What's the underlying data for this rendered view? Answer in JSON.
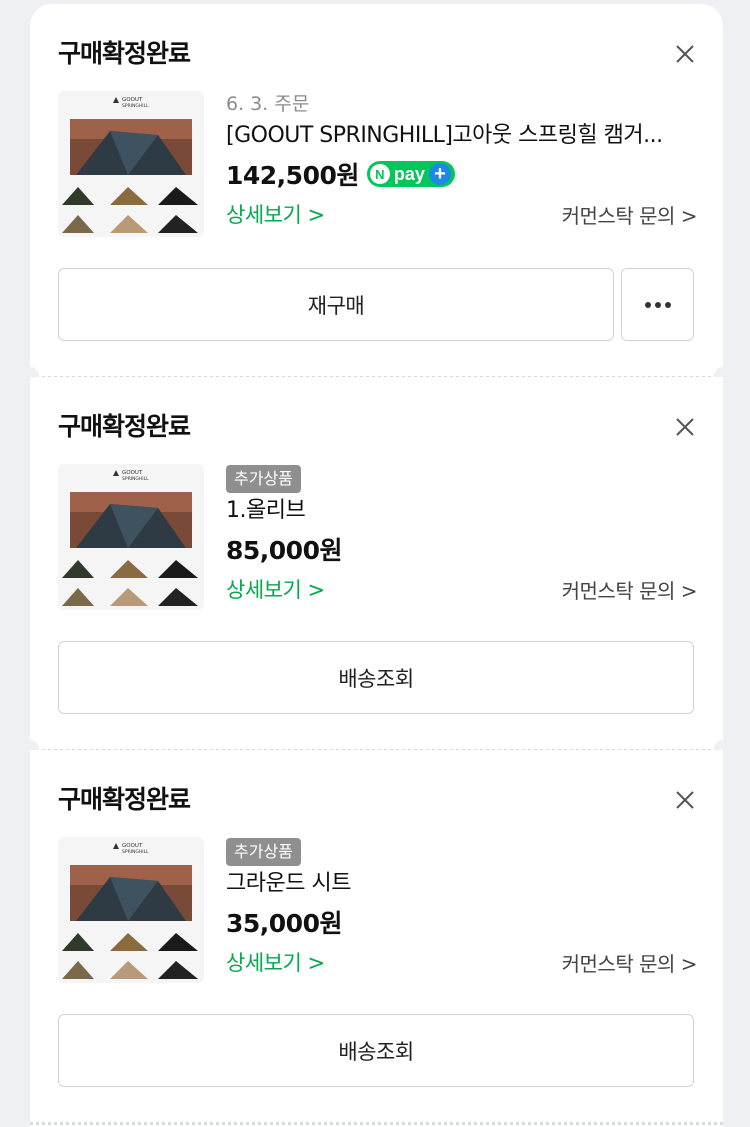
{
  "orders": [
    {
      "status": "구매확정완료",
      "order_date": "6. 3. 주문",
      "badge": "",
      "product_name": "[GOOUT SPRINGHILL]고아웃 스프링힐 캠거...",
      "price": "142,500원",
      "npay": true,
      "npay_label": "pay",
      "detail_link": "상세보기 >",
      "inquiry_link": "커먼스탁 문의 >",
      "button": "재구매",
      "has_more": true
    },
    {
      "status": "구매확정완료",
      "order_date": "",
      "badge": "추가상품",
      "product_name": "1.올리브",
      "price": "85,000원",
      "npay": false,
      "detail_link": "상세보기 >",
      "inquiry_link": "커먼스탁 문의 >",
      "button": "배송조회",
      "has_more": false
    },
    {
      "status": "구매확정완료",
      "order_date": "",
      "badge": "추가상품",
      "product_name": "그라운드 시트",
      "price": "35,000원",
      "npay": false,
      "detail_link": "상세보기 >",
      "inquiry_link": "커먼스탁 문의 >",
      "button": "배송조회",
      "has_more": false
    }
  ],
  "thumbnail": {
    "brand_line1": "GOOUT",
    "brand_line2": "SPRINGHILL"
  },
  "colors": {
    "accent_green": "#03a94d",
    "npay_green": "#03c75a",
    "npay_blue": "#1e88e5"
  }
}
